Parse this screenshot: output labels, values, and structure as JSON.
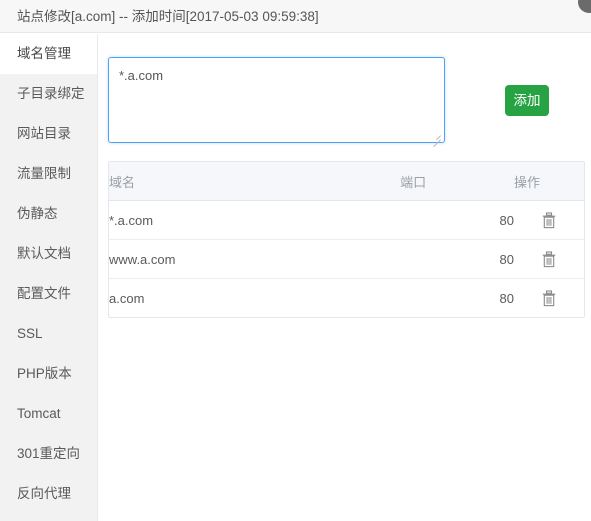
{
  "titlebar": {
    "title": "站点修改[a.com] -- 添加时间[2017-05-03 09:59:38]",
    "close_icon": "close-circle-icon"
  },
  "sidebar": {
    "items": [
      {
        "label": "域名管理",
        "active": true
      },
      {
        "label": "子目录绑定",
        "active": false
      },
      {
        "label": "网站目录",
        "active": false
      },
      {
        "label": "流量限制",
        "active": false
      },
      {
        "label": "伪静态",
        "active": false
      },
      {
        "label": "默认文档",
        "active": false
      },
      {
        "label": "配置文件",
        "active": false
      },
      {
        "label": "SSL",
        "active": false
      },
      {
        "label": "PHP版本",
        "active": false
      },
      {
        "label": "Tomcat",
        "active": false
      },
      {
        "label": "301重定向",
        "active": false
      },
      {
        "label": "反向代理",
        "active": false
      }
    ]
  },
  "form": {
    "textarea_value": "*.a.com",
    "textarea_placeholder": "",
    "add_label": "添加",
    "add_color": "#28a344"
  },
  "table": {
    "headers": {
      "domain": "域名",
      "port": "端口",
      "action": "操作"
    },
    "rows": [
      {
        "domain": "*.a.com",
        "port": "80",
        "action_icon": "trash-icon"
      },
      {
        "domain": "www.a.com",
        "port": "80",
        "action_icon": "trash-icon"
      },
      {
        "domain": "a.com",
        "port": "80",
        "action_icon": "trash-icon"
      }
    ]
  }
}
